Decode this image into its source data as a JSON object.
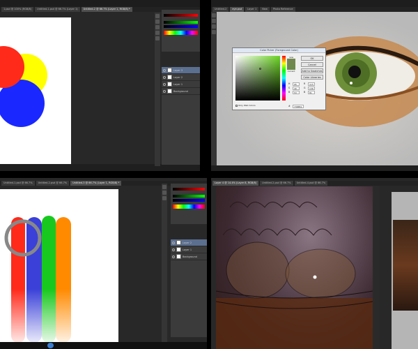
{
  "q1": {
    "tabs": [
      "1.psd @ 100% (RGB/8)",
      "Untitled-1.psd @ 66.7% (Layer 1)",
      "Untitled-2 @ 66.7% (Layer 1, RGB/8) *"
    ],
    "layers": [
      "Layer 3",
      "Layer 2",
      "Layer 1",
      "Background"
    ]
  },
  "q2": {
    "tabs": [
      "Untitled-2",
      "eye.psd",
      "Layer 1",
      "New",
      "Photo Reference"
    ],
    "dialog": {
      "title": "Color Picker (Foreground Color)",
      "ok": "OK",
      "cancel": "Cancel",
      "add_to_swatches": "Add to Swatches",
      "color_libraries": "Color Libraries",
      "new_label": "new",
      "current_label": "current",
      "only_web_colors": "Only Web Colors",
      "fields": [
        {
          "label": "H",
          "value": "95"
        },
        {
          "label": "S",
          "value": "40"
        },
        {
          "label": "B",
          "value": "53"
        },
        {
          "label": "R",
          "value": "115"
        },
        {
          "label": "G",
          "value": "136"
        },
        {
          "label": "B",
          "value": "81"
        }
      ],
      "hex": "738851",
      "new_color": "#738851",
      "current_color": "#6e8a4c"
    }
  },
  "q3": {
    "tabs": [
      "Untitled-1.psd @ 66.7%",
      "Untitled-2.psd @ 66.7%",
      "Untitled-3 @ 66.7% (Layer 1, RGB/8) *"
    ],
    "layers": [
      "Layer 2",
      "Layer 1",
      "Background"
    ]
  },
  "q4": {
    "tabs": [
      "Layer 4 @ 14.4% (Layer 8, RGB/8)",
      "Untitled-2.psd @ 66.7%",
      "Untitled-4.psd @ 66.7%"
    ]
  },
  "colors": {
    "red": "#ff2a1a",
    "yellow": "#ffff00",
    "blue": "#1a28ff",
    "green": "#18c81e",
    "orange": "#ff8a00",
    "purple": "#3a40d8"
  }
}
